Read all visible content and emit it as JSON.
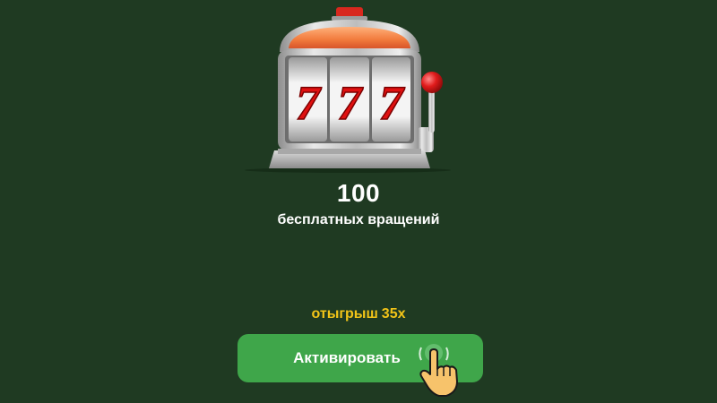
{
  "bonus": {
    "count": "100",
    "description": "бесплатных вращений"
  },
  "wager": {
    "label": "отыгрыш",
    "value": "35x"
  },
  "activate_button": {
    "label": "Активировать"
  },
  "colors": {
    "background": "#1f3a22",
    "accent_yellow": "#f2c418",
    "button_green": "#3fa64a",
    "text_white": "#ffffff"
  },
  "icons": {
    "illustration": "slot-machine-icon",
    "pointer": "pointing-hand-icon"
  }
}
